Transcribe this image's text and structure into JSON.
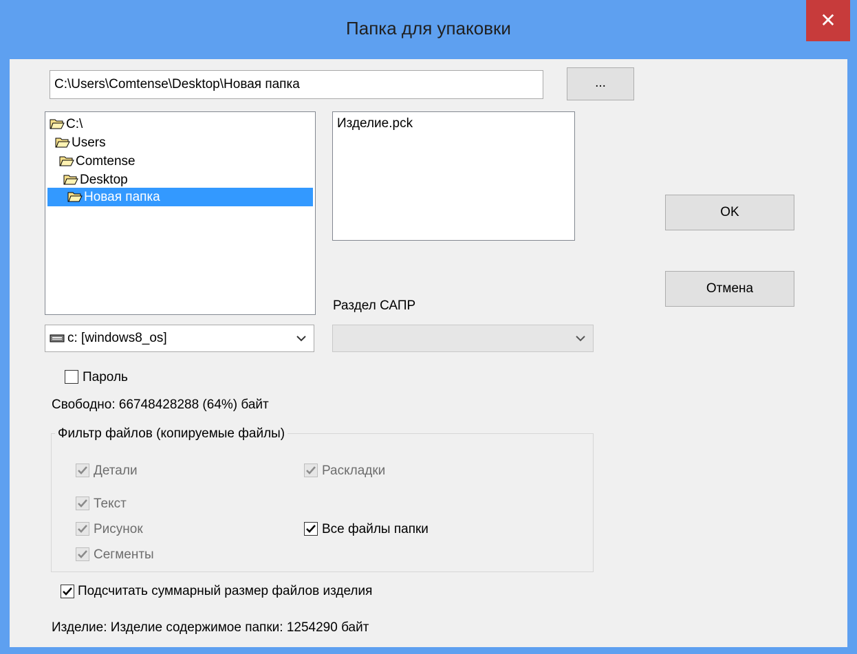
{
  "window": {
    "title": "Папка для упаковки",
    "close_symbol": "✕"
  },
  "path": {
    "value": "C:\\Users\\Comtense\\Desktop\\Новая папка",
    "browse_label": "..."
  },
  "tree": {
    "items": [
      "C:\\",
      "Users",
      "Comtense",
      "Desktop",
      "Новая папка"
    ],
    "selected_index": 4
  },
  "files": {
    "items": [
      "Изделие.pck"
    ]
  },
  "drive": {
    "selected": "c: [windows8_os]",
    "icon": "drive-icon"
  },
  "cad_section": {
    "label": "Раздел САПР",
    "selected": ""
  },
  "buttons": {
    "ok": "OK",
    "cancel": "Отмена"
  },
  "password": {
    "label": "Пароль",
    "checked": false
  },
  "free_space": "Свободно: 66748428288 (64%)  байт",
  "filter": {
    "title": "Фильтр файлов (копируемые файлы)",
    "details": "Детали",
    "layouts": "Раскладки",
    "text": "Текст",
    "drawing": "Рисунок",
    "segments": "Сегменты",
    "all_files": "Все файлы папки"
  },
  "count_total": {
    "label": "Подсчитать суммарный размер файлов изделия",
    "checked": true
  },
  "status": "Изделие: Изделие   содержимое папки: 1254290 байт"
}
